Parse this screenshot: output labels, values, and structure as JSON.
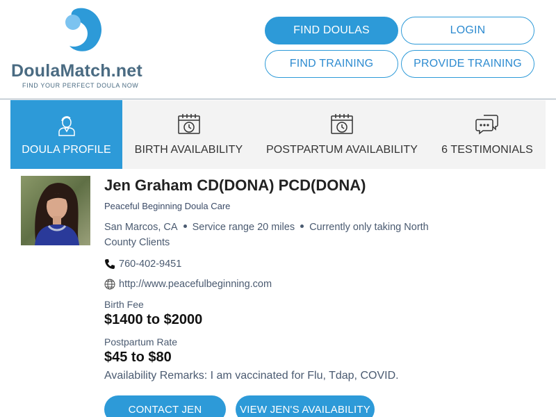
{
  "brand": {
    "name_part1": "Doula",
    "name_part2": "Match",
    "name_part3": ".net",
    "tagline": "FIND YOUR PERFECT DOULA NOW",
    "primary_color": "#2d9ad8",
    "logo_color": "#4a6b82"
  },
  "nav": {
    "find_doulas": "FIND DOULAS",
    "login": "LOGIN",
    "find_training": "FIND TRAINING",
    "provide_training": "PROVIDE TRAINING"
  },
  "tabs": [
    {
      "label": "DOULA PROFILE",
      "icon": "doula-person-icon",
      "active": true
    },
    {
      "label": "BIRTH AVAILABILITY",
      "icon": "calendar-clock-icon",
      "active": false
    },
    {
      "label": "POSTPARTUM AVAILABILITY",
      "icon": "calendar-clock-icon",
      "active": false
    },
    {
      "label": "6 TESTIMONIALS",
      "icon": "chat-bubbles-icon",
      "active": false
    }
  ],
  "profile": {
    "name": "Jen Graham CD(DONA) PCD(DONA)",
    "business": "Peaceful Beginning Doula Care",
    "city": "San Marcos, CA",
    "service_range": "Service range 20 miles",
    "availability_note": "Currently only taking North County Clients",
    "phone": "760-402-9451",
    "website": "http://www.peacefulbeginning.com",
    "birth_fee_label": "Birth Fee",
    "birth_fee_value": "$1400 to $2000",
    "postpartum_label": "Postpartum Rate",
    "postpartum_value": "$45 to $80",
    "remarks": "Availability Remarks: I am vaccinated for Flu, Tdap, COVID."
  },
  "actions": {
    "contact": "CONTACT JEN",
    "availability": "VIEW JEN'S AVAILABILITY"
  }
}
